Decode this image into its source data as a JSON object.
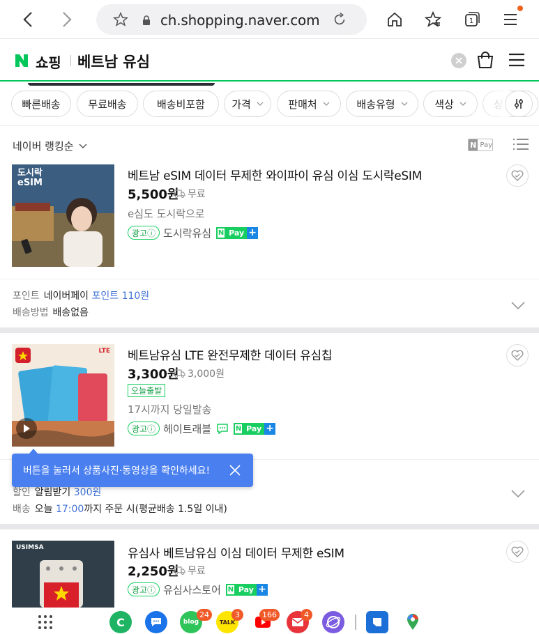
{
  "browser": {
    "url": "ch.shopping.naver.com",
    "tab_count": "1"
  },
  "header": {
    "logo_letter": "N",
    "service_name": "쇼핑",
    "query": "베트남 유심"
  },
  "filters": [
    "빠른배송",
    "무료배송",
    "배송비포함",
    "가격",
    "판매처",
    "배송유형",
    "색상",
    "상"
  ],
  "sort": {
    "label": "네이버 랭킹순",
    "npay_label": "Pay"
  },
  "products": [
    {
      "thumb_text": "도시락\neSIM",
      "title": "베트남 eSIM 데이터 무제한 와이파이 유심 이심 도시락eSIM",
      "price": "5,500원",
      "shipping": "무료",
      "desc": "e심도 도시락으로",
      "ad": "광고ⓘ",
      "seller": "도시락유심",
      "point_label": "포인트",
      "point_value": "네이버페이",
      "point_amount": "포인트 110원",
      "delivery_label": "배송방법",
      "delivery_value": "배송없음"
    },
    {
      "thumb_text": "LTE",
      "title": "베트남유심 LTE 완전무제한 데이터 유심칩",
      "price": "3,300원",
      "shipping": "3,000원",
      "badge": "오늘출발",
      "desc": "17시까지 당일발송",
      "ad": "광고ⓘ",
      "seller": "헤이트래블",
      "discount_label": "할인",
      "discount_value": "알림받기",
      "discount_amount": "300원",
      "delivery_label": "배송",
      "delivery_prefix": "오늘",
      "delivery_time": "17:00",
      "delivery_suffix": "까지 주문 시(평균배송 1.5일 이내)"
    },
    {
      "thumb_text": "USIMSA",
      "title": "유심사 베트남유심 이심 데이터 무제한 eSIM",
      "price": "2,250원",
      "shipping": "무료",
      "ad": "광고ⓘ",
      "seller": "유심사스토어"
    }
  ],
  "tooltip": "버튼을 눌러서 상품사진·동영상을 확인하세요!",
  "dock": {
    "badges": {
      "blog": "24",
      "talk": "3",
      "youtube": "166",
      "mail": "4"
    },
    "talk_label": "TALK",
    "blog_label": "blog"
  },
  "colors": {
    "naver_green": "#03c75a",
    "tooltip_blue": "#4a7ff0",
    "link_blue": "#3f71d6"
  }
}
